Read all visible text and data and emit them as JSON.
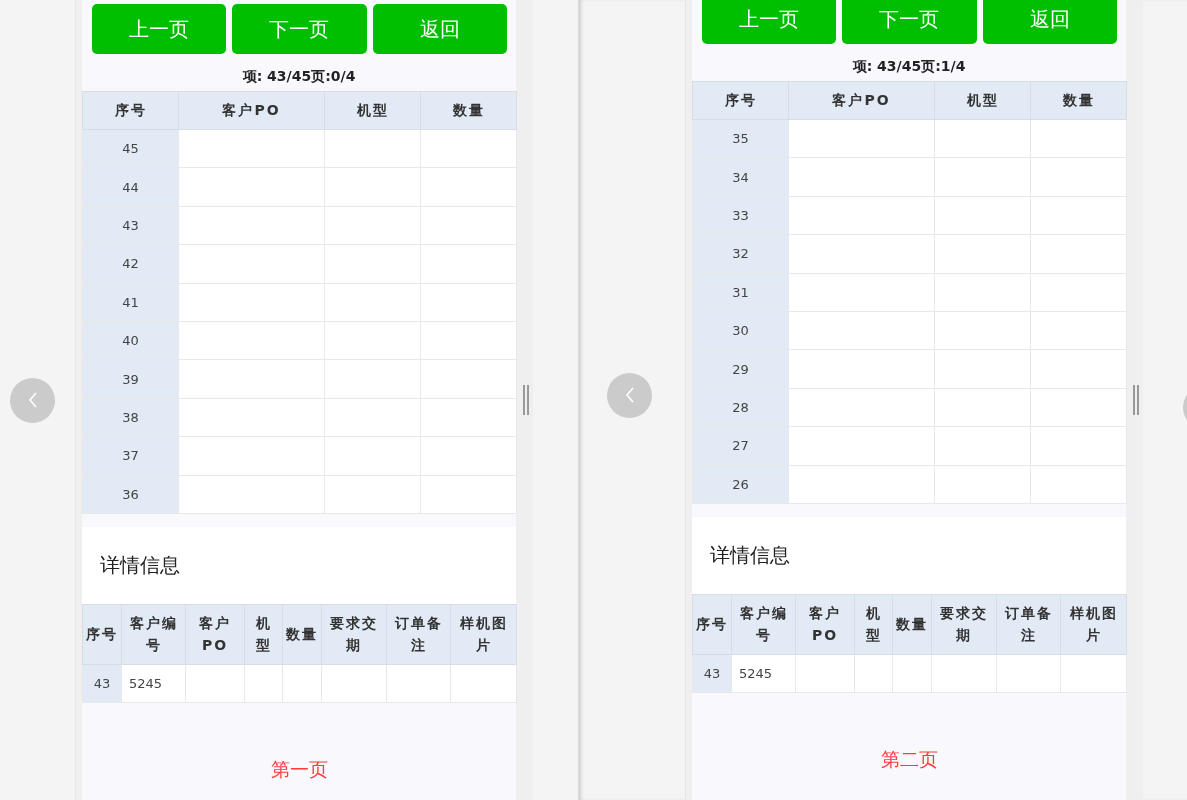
{
  "panels": [
    {
      "buttons": [
        "上一页",
        "下一页",
        "返回"
      ],
      "info": "项: 43/45页:0/4",
      "list_table": {
        "columns": [
          "序号",
          "客户PO",
          "机型",
          "数量"
        ],
        "rows": [
          {
            "cells": [
              "45"
            ]
          },
          {
            "cells": [
              "44"
            ]
          },
          {
            "cells": [
              "43"
            ]
          },
          {
            "cells": [
              "42"
            ]
          },
          {
            "cells": [
              "41"
            ]
          },
          {
            "cells": [
              "40"
            ]
          },
          {
            "cells": [
              "39"
            ]
          },
          {
            "cells": [
              "38"
            ]
          },
          {
            "cells": [
              "37"
            ]
          },
          {
            "cells": [
              "36"
            ]
          }
        ]
      },
      "detail_title": "详情信息",
      "detail_table": {
        "columns": [
          "序号",
          "客户编号",
          "客户PO",
          "机型",
          "数量",
          "要求交期",
          "订单备注",
          "样机图片"
        ],
        "rows": [
          {
            "cells": [
              "43",
              "5245"
            ]
          }
        ]
      },
      "footer": "第一页"
    },
    {
      "buttons": [
        "上一页",
        "下一页",
        "返回"
      ],
      "info": "项: 43/45页:1/4",
      "list_table": {
        "columns": [
          "序号",
          "客户PO",
          "机型",
          "数量"
        ],
        "rows": [
          {
            "cells": [
              "35"
            ]
          },
          {
            "cells": [
              "34"
            ]
          },
          {
            "cells": [
              "33"
            ]
          },
          {
            "cells": [
              "32"
            ]
          },
          {
            "cells": [
              "31"
            ]
          },
          {
            "cells": [
              "30"
            ]
          },
          {
            "cells": [
              "29"
            ]
          },
          {
            "cells": [
              "28"
            ]
          },
          {
            "cells": [
              "27"
            ]
          },
          {
            "cells": [
              "26"
            ]
          }
        ]
      },
      "detail_title": "详情信息",
      "detail_table": {
        "columns": [
          "序号",
          "客户编号",
          "客户PO",
          "机型",
          "数量",
          "要求交期",
          "订单备注",
          "样机图片"
        ],
        "rows": [
          {
            "cells": [
              "43",
              "5245"
            ]
          }
        ]
      },
      "footer": "第二页"
    }
  ]
}
